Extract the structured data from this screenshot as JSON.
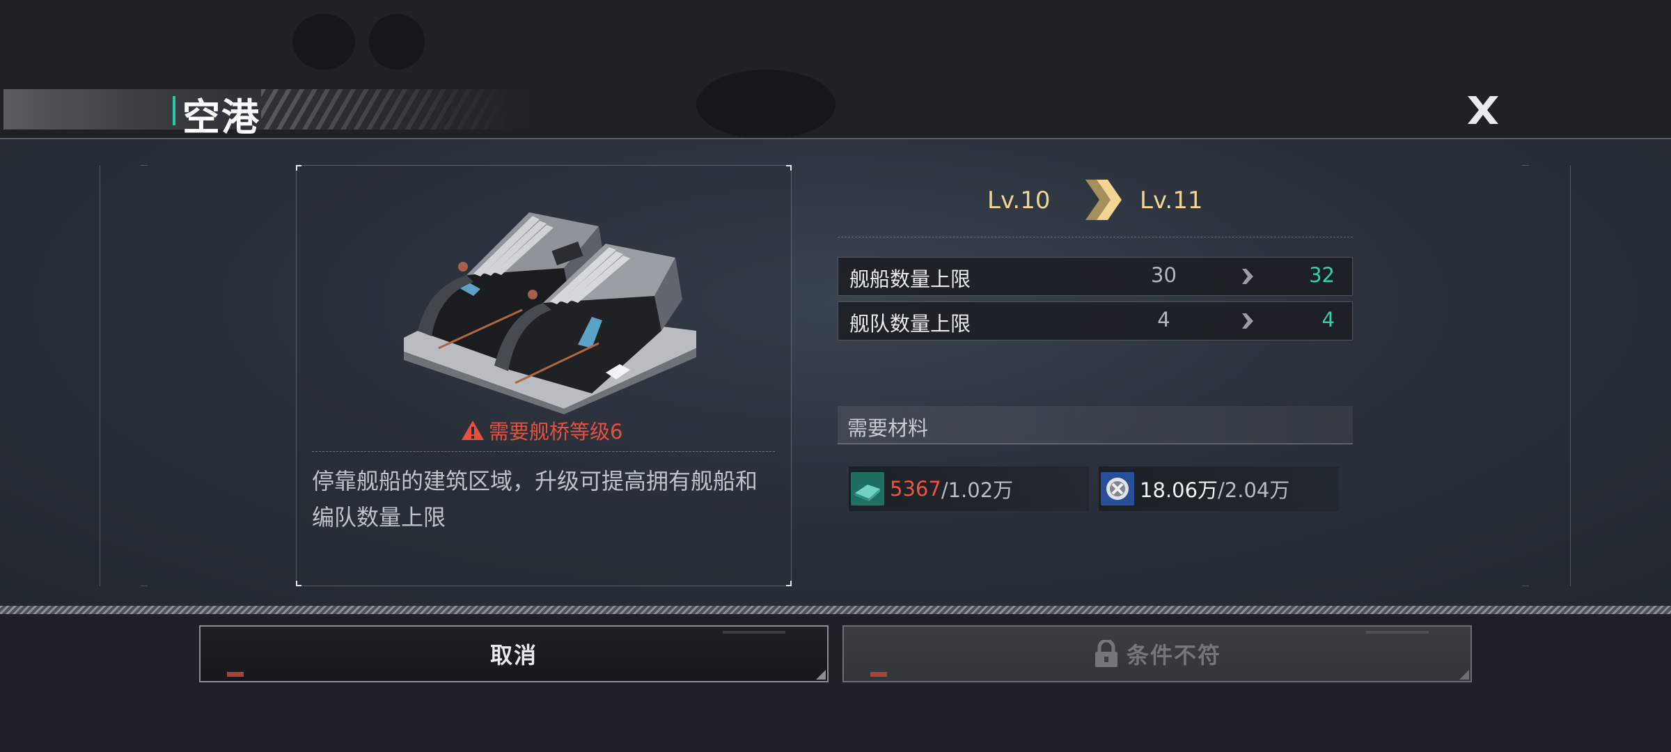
{
  "title": "空港",
  "icons": {
    "close": "close-icon",
    "warning": "warning-icon",
    "level_arrow": "double-chevron-right-icon",
    "stat_arrow": "chevron-right-icon",
    "lock": "lock-icon",
    "material_1": "ore-material-icon",
    "material_2": "alloy-coin-icon"
  },
  "building": {
    "warning": "需要舰桥等级6",
    "description": "停靠舰船的建筑区域，升级可提高拥有舰船和编队数量上限"
  },
  "level": {
    "current": "Lv.10",
    "next": "Lv.11"
  },
  "stats": [
    {
      "label": "舰船数量上限",
      "current": "30",
      "next": "32"
    },
    {
      "label": "舰队数量上限",
      "current": "4",
      "next": "4"
    }
  ],
  "materials": {
    "header": "需要材料",
    "items": [
      {
        "have": "5367",
        "need": "/1.02万",
        "sufficient": false
      },
      {
        "have": "18.06万",
        "need": "/2.04万",
        "sufficient": true
      }
    ]
  },
  "buttons": {
    "cancel": "取消",
    "disabled": "条件不符"
  },
  "colors": {
    "accent": "#27c9a6",
    "level": "#f2d593",
    "increase": "#2ed3a6",
    "insufficient": "#f05440",
    "warning": "#e5503f"
  }
}
